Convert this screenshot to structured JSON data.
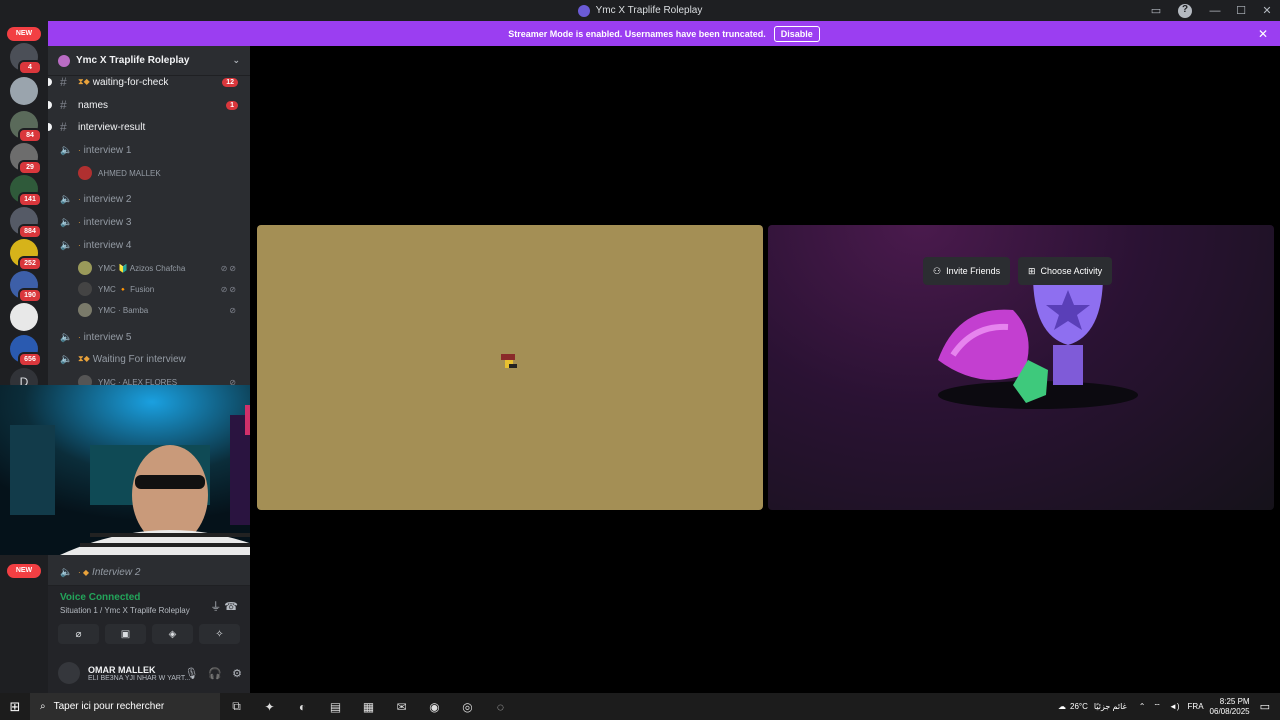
{
  "window": {
    "title": "Ymc X Traplife Roleplay"
  },
  "banner": {
    "text": "Streamer Mode is enabled. Usernames have been truncated.",
    "button": "Disable"
  },
  "guilds": {
    "new_label": "NEW",
    "badges": [
      "4",
      "84",
      "29",
      "141",
      "884",
      "252",
      "190",
      "656"
    ],
    "dm_letter": "D"
  },
  "server": {
    "name": "Ymc X Traplife Roleplay"
  },
  "channels": [
    {
      "name": "waiting-for-check",
      "count": "12"
    },
    {
      "name": "names",
      "count": "1"
    },
    {
      "name": "interview-result"
    },
    {
      "name": "interview 1"
    },
    {
      "name": "interview 2"
    },
    {
      "name": "interview 3"
    },
    {
      "name": "interview 4"
    },
    {
      "name": "interview 5"
    },
    {
      "name": "Waiting For interview"
    },
    {
      "name": "Interview 2"
    }
  ],
  "voice_users": {
    "u1": "AHMED MALLEK",
    "u2": "YMC 🔰 Azizos Chafcha",
    "u3": "YMC 🔸 Fusion",
    "u4": "YMC · Bamba",
    "u5": "YMC · ALEX FLORES"
  },
  "voice": {
    "status": "Voice Connected",
    "location": "Situation 1 / Ymc X Traplife Roleplay"
  },
  "user_panel": {
    "name": "OMAR MALLEK",
    "status": "ELI BE3NA YJI NHAR W YART..."
  },
  "activity": {
    "invite": "Invite Friends",
    "choose": "Choose Activity"
  },
  "taskbar": {
    "search_placeholder": "Taper ici pour rechercher",
    "weather": "26°C",
    "weather_text": "غائم جزئيًا",
    "lang": "FRA",
    "time": "8:25 PM",
    "date": "06/08/2025"
  },
  "colors": {
    "accent": "#9b3ef1",
    "voice_green": "#23a55a",
    "badge_red": "#da373c",
    "left_tile": "#a48f55"
  }
}
